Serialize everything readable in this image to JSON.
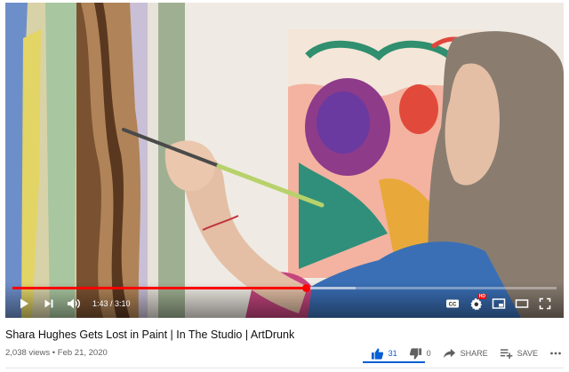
{
  "video": {
    "current_time": "1:43",
    "separator": " / ",
    "duration": "3:10",
    "played_fraction": 0.54,
    "buffered_fraction": 0.63,
    "accent_color": "#ff0000"
  },
  "controls": {
    "left_icons": [
      "play-icon",
      "next-icon",
      "volume-icon"
    ],
    "right_icons": [
      "subtitles-icon",
      "settings-icon",
      "miniplayer-icon",
      "theater-icon",
      "fullscreen-icon"
    ],
    "settings_badge": "HD"
  },
  "title": "Shara Hughes Gets Lost in Paint | In The Studio | ArtDrunk",
  "meta": {
    "views": "2,038 views",
    "dot": " • ",
    "date": "Feb 21, 2020"
  },
  "actions": {
    "likes": "31",
    "dislikes": "0",
    "share_label": "SHARE",
    "save_label": "SAVE",
    "like_color": "#065fd4",
    "like_ratio": 1.0
  }
}
